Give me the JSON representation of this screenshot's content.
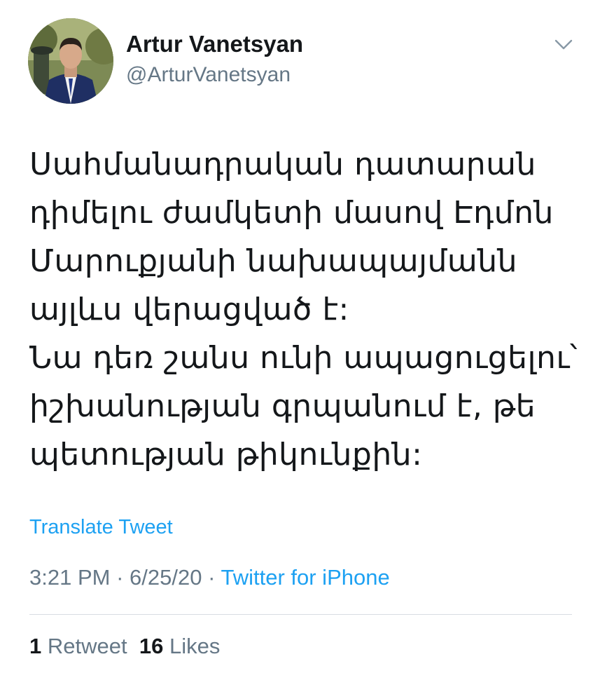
{
  "author": {
    "display_name": "Artur Vanetsyan",
    "handle": "@ArturVanetsyan",
    "avatar_icon": "profile-photo"
  },
  "menu_icon": "chevron-down-icon",
  "tweet": {
    "lines": [
      "Սահմանադրական դատարան",
      "դիմելու ժամկետի մասով Էդմոն",
      "Մարուքյանի նախապայմանն",
      "այլևս վերացված է:",
      "Նա դեռ շանս ունի ապացուցելու՝",
      "իշխանության գրպանում է, թե",
      "պետության թիկունքին:"
    ],
    "translate_label": "Translate Tweet",
    "time": "3:21 PM",
    "date": "6/25/20",
    "separator": "·",
    "source": "Twitter for iPhone"
  },
  "stats": {
    "retweets_count": "1",
    "retweets_label": "Retweet",
    "likes_count": "16",
    "likes_label": "Likes"
  },
  "colors": {
    "link": "#1da1f2",
    "secondary_text": "#657786",
    "primary_text": "#14171a",
    "divider": "#d8dde2"
  }
}
